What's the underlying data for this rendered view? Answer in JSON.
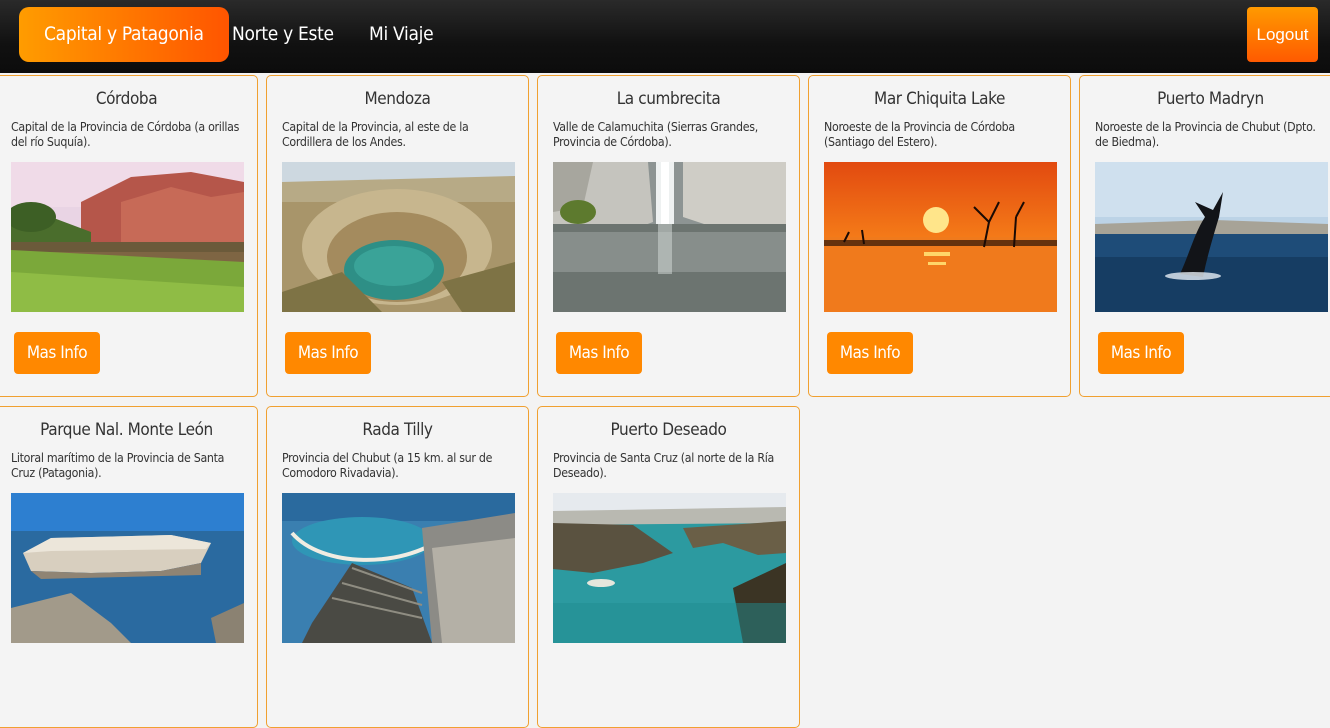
{
  "nav": {
    "tabs": [
      {
        "label": "Capital y Patagonia",
        "active": true
      },
      {
        "label": "Norte y Este",
        "active": false
      },
      {
        "label": "Mi Viaje",
        "active": false
      }
    ],
    "logout_label": "Logout"
  },
  "colors": {
    "accent": "#ff8800",
    "nav_bg": "#111111",
    "card_border": "#f0a030"
  },
  "cards": [
    {
      "title": "Córdoba",
      "description": "Capital de la Provincia de Córdoba (a orillas del río Suquía).",
      "button": "Mas Info"
    },
    {
      "title": "Mendoza",
      "description": "Capital de la Provincia, al este de la Cordillera de los Andes.",
      "button": "Mas Info"
    },
    {
      "title": "La cumbrecita",
      "description": "Valle de Calamuchita (Sierras Grandes, Provincia de Córdoba).",
      "button": "Mas Info"
    },
    {
      "title": "Mar Chiquita Lake",
      "description": "Noroeste de la Provincia de Córdoba (Santiago del Estero).",
      "button": "Mas Info"
    },
    {
      "title": "Puerto Madryn",
      "description": "Noroeste de la Provincia de Chubut (Dpto. de Biedma).",
      "button": "Mas Info"
    },
    {
      "title": "Parque Nal. Monte León",
      "description": "Litoral marítimo de la Provincia de Santa Cruz (Patagonia).",
      "button": "Mas Info"
    },
    {
      "title": "Rada Tilly",
      "description": "Provincia del Chubut (a 15 km. al sur de Comodoro Rivadavia).",
      "button": "Mas Info"
    },
    {
      "title": "Puerto Deseado",
      "description": "Provincia de Santa Cruz (al norte de la Ría Deseado).",
      "button": "Mas Info"
    }
  ]
}
